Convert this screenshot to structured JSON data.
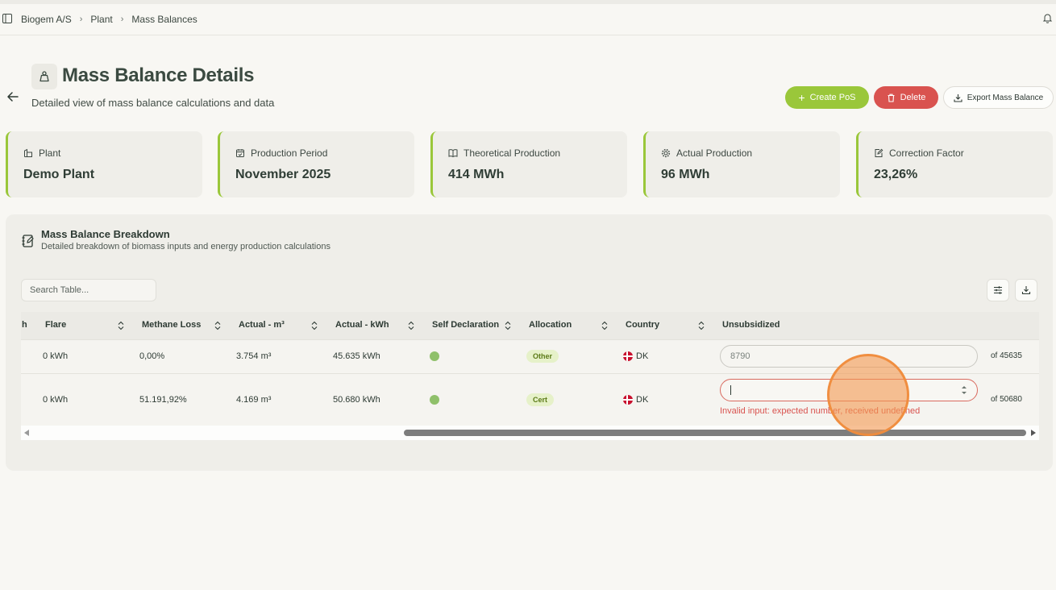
{
  "topbar": {
    "breadcrumbs": [
      "Biogem A/S",
      "Plant",
      "Mass Balances"
    ]
  },
  "header": {
    "title": "Mass Balance Details",
    "subtitle": "Detailed view of mass balance calculations and data"
  },
  "actions": {
    "create_label": "Create PoS",
    "delete_label": "Delete",
    "export_label": "Export Mass Balance"
  },
  "stats": [
    {
      "label": "Plant",
      "value": "Demo Plant",
      "icon": "building-icon"
    },
    {
      "label": "Production Period",
      "value": "November 2025",
      "icon": "calendar-icon"
    },
    {
      "label": "Theoretical Production",
      "value": "414 MWh",
      "icon": "book-icon"
    },
    {
      "label": "Actual Production",
      "value": "96 MWh",
      "icon": "gear-icon"
    },
    {
      "label": "Correction Factor",
      "value": "23,26%",
      "icon": "edit-icon"
    }
  ],
  "breakdown": {
    "title": "Mass Balance Breakdown",
    "subtitle": "Detailed breakdown of biomass inputs and energy production calculations",
    "search_placeholder": "Search Table..."
  },
  "table": {
    "columns": [
      "h",
      "Flare",
      "Methane Loss",
      "Actual - m³",
      "Actual - kWh",
      "Self Declaration",
      "Allocation",
      "Country",
      "Unsubsidized"
    ],
    "rows": [
      {
        "flare": "0 kWh",
        "methane_loss": "0,00%",
        "actual_m3": "3.754 m³",
        "actual_kwh": "45.635 kWh",
        "self_declaration": true,
        "allocation": "Other",
        "country": "DK",
        "unsubsidized_value": "8790",
        "of_text": "of 45635"
      },
      {
        "flare": "0 kWh",
        "methane_loss": "51.191,92%",
        "actual_m3": "4.169 m³",
        "actual_kwh": "50.680 kWh",
        "self_declaration": true,
        "allocation": "Cert",
        "country": "DK",
        "unsubsidized_value": "",
        "of_text": "of 50680",
        "error": "Invalid input: expected number, received undefined"
      }
    ]
  },
  "colors": {
    "accent": "#9ac73a",
    "danger": "#d9534f",
    "background": "#f8f7f3",
    "card": "#efeee9"
  }
}
